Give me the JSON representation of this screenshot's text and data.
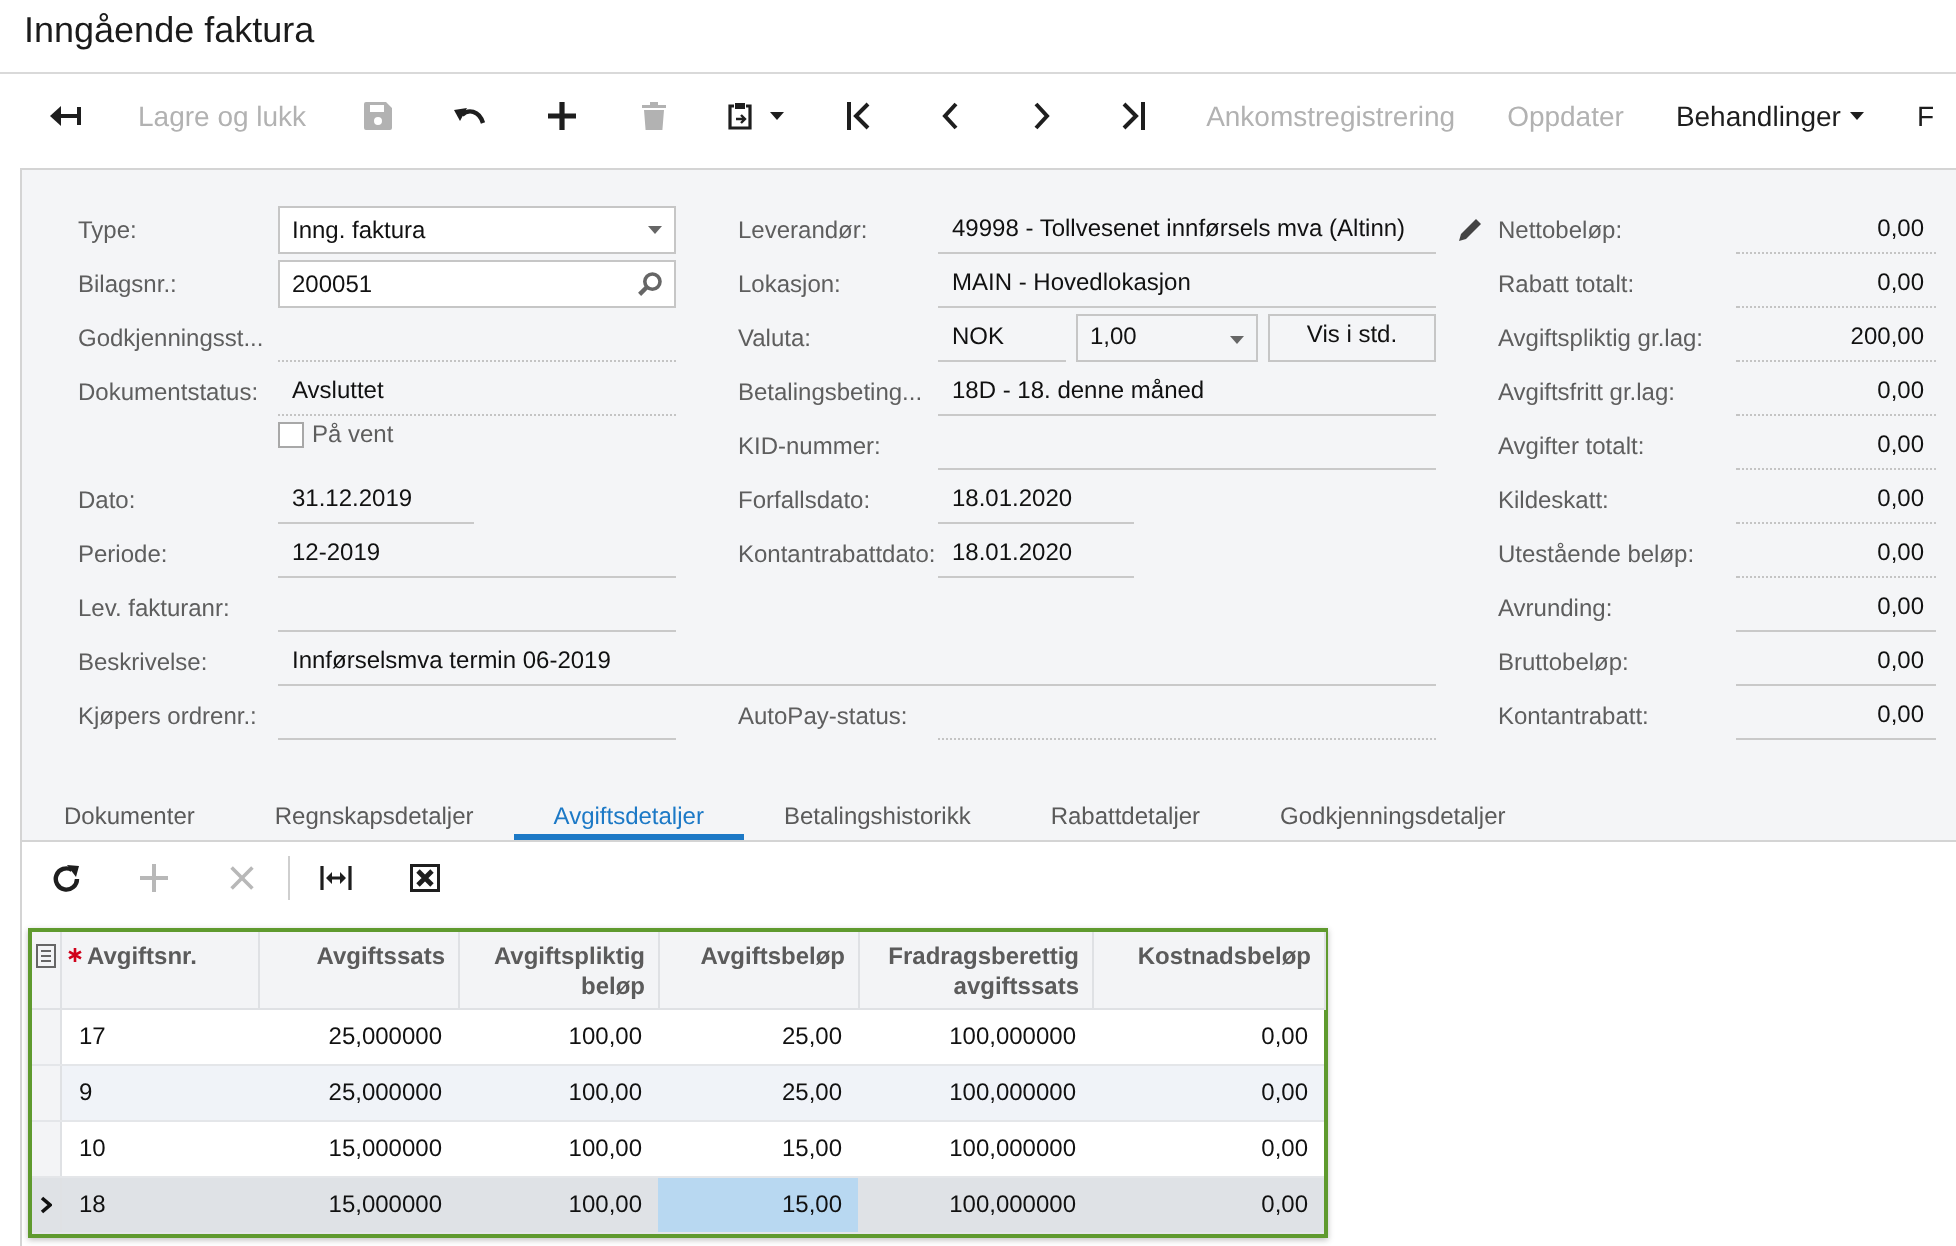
{
  "window": {
    "title": "Inngående faktura"
  },
  "toolbar": [
    {
      "kind": "back",
      "disabled": false
    },
    {
      "kind": "text",
      "label": "Lagre og lukk",
      "disabled": true
    },
    {
      "kind": "save",
      "disabled": true
    },
    {
      "kind": "undo",
      "disabled": false
    },
    {
      "kind": "add",
      "disabled": false
    },
    {
      "kind": "delete",
      "disabled": true
    },
    {
      "kind": "paste",
      "disabled": false
    },
    {
      "kind": "first",
      "disabled": false
    },
    {
      "kind": "previous",
      "disabled": false
    },
    {
      "kind": "next",
      "disabled": false
    },
    {
      "kind": "last",
      "disabled": false
    },
    {
      "kind": "text",
      "label": "Ankomstregistrering",
      "disabled": true
    },
    {
      "kind": "text",
      "label": "Oppdater",
      "disabled": true
    },
    {
      "kind": "menu",
      "label": "Behandlinger",
      "disabled": false
    },
    {
      "kind": "text",
      "label": "F",
      "disabled": false
    }
  ],
  "form": {
    "main_fields": [
      {
        "kind": "dropdown",
        "label": "Type:",
        "value": "Inng. faktura"
      },
      {
        "kind": "lookup",
        "label": "Bilagsnr.:",
        "value": "200051"
      },
      {
        "kind": "readonly",
        "label": "Godkjenningsst..."
      },
      {
        "kind": "readonly",
        "label": "Dokumentstatus:",
        "value": "Avsluttet"
      },
      {
        "kind": "checkbox",
        "label": "På vent",
        "checked": false
      },
      {
        "kind": "date",
        "label": "Dato:",
        "value": "31.12.2019"
      },
      {
        "kind": "text",
        "label": "Periode:",
        "value": "12-2019"
      },
      {
        "kind": "text",
        "label": "Lev. fakturanr:"
      }
    ],
    "supplier_fields": [
      {
        "kind": "text",
        "label": "Leverandør:",
        "value": "49998 - Tollvesenet innførsels mva (Altinn)",
        "editable": true
      },
      {
        "kind": "text",
        "label": "Lokasjon:",
        "value": "MAIN - Hovedlokasjon",
        "editable": false
      },
      {
        "kind": "currency",
        "label": "Valuta:",
        "value": "NOK",
        "rate": "1,00",
        "button": "Vis i std.",
        "editable": false
      },
      {
        "kind": "text",
        "label": "Betalingsbeting...",
        "value": "18D - 18. denne måned",
        "editable": false
      },
      {
        "kind": "text",
        "label": "KID-nummer:",
        "editable": false
      },
      {
        "kind": "date",
        "label": "Forfallsdato:",
        "value": "18.01.2020",
        "editable": false
      },
      {
        "kind": "date",
        "label": "Kontantrabattdato:",
        "value": "18.01.2020",
        "editable": false
      }
    ],
    "description": {
      "kind": "text",
      "label": "Beskrivelse:",
      "value": "Innførselsmva termin 06-2019"
    },
    "bottom_fields": [
      {
        "kind": "text",
        "label": "Kjøpers ordrenr.:"
      },
      {
        "kind": "readonly",
        "label": "AutoPay-status:"
      }
    ],
    "totals": [
      {
        "kind": "readonly",
        "label": "Nettobeløp:",
        "value": "0,00"
      },
      {
        "kind": "readonly",
        "label": "Rabatt totalt:",
        "value": "0,00"
      },
      {
        "kind": "readonly",
        "label": "Avgiftspliktig gr.lag:",
        "value": "200,00"
      },
      {
        "kind": "readonly",
        "label": "Avgiftsfritt gr.lag:",
        "value": "0,00"
      },
      {
        "kind": "readonly",
        "label": "Avgifter totalt:",
        "value": "0,00"
      },
      {
        "kind": "readonly",
        "label": "Kildeskatt:",
        "value": "0,00"
      },
      {
        "kind": "readonly",
        "label": "Utestående beløp:",
        "value": "0,00"
      },
      {
        "kind": "text",
        "label": "Avrunding:",
        "value": "0,00"
      },
      {
        "kind": "text",
        "label": "Bruttobeløp:",
        "value": "0,00"
      },
      {
        "kind": "text",
        "label": "Kontantrabatt:",
        "value": "0,00"
      }
    ]
  },
  "tabs": [
    {
      "label": "Dokumenter",
      "selected": false
    },
    {
      "label": "Regnskapsdetaljer",
      "selected": false
    },
    {
      "label": "Avgiftsdetaljer",
      "selected": true
    },
    {
      "label": "Betalingshistorikk",
      "selected": false
    },
    {
      "label": "Rabattdetaljer",
      "selected": false
    },
    {
      "label": "Godkjenningsdetaljer",
      "selected": false
    }
  ],
  "grid_toolbar": {
    "groups": [
      [
        {
          "kind": "refresh",
          "disabled": false
        },
        {
          "kind": "add",
          "disabled": true
        },
        {
          "kind": "delete",
          "disabled": true
        }
      ],
      [
        {
          "kind": "fit",
          "disabled": false
        },
        {
          "kind": "export",
          "disabled": false
        }
      ]
    ]
  },
  "table": {
    "columns": [
      {
        "label": "Avgiftsnr.",
        "required": true
      },
      {
        "label": "Avgiftssats",
        "required": false
      },
      {
        "label": "Avgiftspliktig beløp",
        "required": false
      },
      {
        "label": "Avgiftsbeløp",
        "required": false
      },
      {
        "label": "Fradragsberettig avgiftssats",
        "required": false
      },
      {
        "label": "Kostnadsbeløp",
        "required": false
      }
    ],
    "rows": [
      {
        "selected": false,
        "cells": [
          {
            "text": "17",
            "selected": false
          },
          {
            "text": "25,000000",
            "selected": false
          },
          {
            "text": "100,00",
            "selected": false
          },
          {
            "text": "25,00",
            "selected": false
          },
          {
            "text": "100,000000",
            "selected": false
          },
          {
            "text": "0,00",
            "selected": false
          }
        ]
      },
      {
        "selected": false,
        "cells": [
          {
            "text": "9",
            "selected": false
          },
          {
            "text": "25,000000",
            "selected": false
          },
          {
            "text": "100,00",
            "selected": false
          },
          {
            "text": "25,00",
            "selected": false
          },
          {
            "text": "100,000000",
            "selected": false
          },
          {
            "text": "0,00",
            "selected": false
          }
        ]
      },
      {
        "selected": false,
        "cells": [
          {
            "text": "10",
            "selected": false
          },
          {
            "text": "15,000000",
            "selected": false
          },
          {
            "text": "100,00",
            "selected": false
          },
          {
            "text": "15,00",
            "selected": false
          },
          {
            "text": "100,000000",
            "selected": false
          },
          {
            "text": "0,00",
            "selected": false
          }
        ]
      },
      {
        "selected": true,
        "cells": [
          {
            "text": "18",
            "selected": false
          },
          {
            "text": "15,000000",
            "selected": false
          },
          {
            "text": "100,00",
            "selected": false
          },
          {
            "text": "15,00",
            "selected": true
          },
          {
            "text": "100,000000",
            "selected": false
          },
          {
            "text": "0,00",
            "selected": false
          }
        ]
      }
    ]
  }
}
